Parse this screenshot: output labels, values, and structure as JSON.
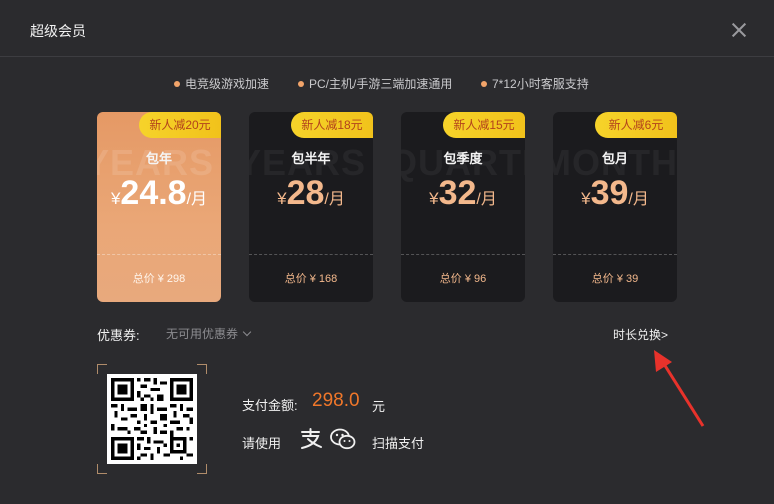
{
  "window": {
    "title": "超级会员"
  },
  "features": [
    {
      "label": "电竞级游戏加速"
    },
    {
      "label": "PC/主机/手游三端加速通用"
    },
    {
      "label": "7*12小时客服支持"
    }
  ],
  "plans": [
    {
      "badge": "新人减20元",
      "watermark": "YEARS",
      "name": "包年",
      "currency": "¥",
      "price": "24.8",
      "unit": "/月",
      "total": "总价 ¥ 298",
      "selected": true
    },
    {
      "badge": "新人减18元",
      "watermark": "YEARS",
      "name": "包半年",
      "currency": "¥",
      "price": "28",
      "unit": "/月",
      "total": "总价 ¥ 168",
      "selected": false
    },
    {
      "badge": "新人减15元",
      "watermark": "QUARTER",
      "name": "包季度",
      "currency": "¥",
      "price": "32",
      "unit": "/月",
      "total": "总价 ¥ 96",
      "selected": false
    },
    {
      "badge": "新人减6元",
      "watermark": "MONTH",
      "name": "包月",
      "currency": "¥",
      "price": "39",
      "unit": "/月",
      "total": "总价 ¥ 39",
      "selected": false
    }
  ],
  "coupon": {
    "label": "优惠券:",
    "value": "无可用优惠券"
  },
  "redeem": {
    "label": "时长兑换>"
  },
  "payment": {
    "amount_label": "支付金额:",
    "amount": "298.0",
    "unit": "元",
    "use_label": "请使用",
    "scan_label": "扫描支付",
    "methods": [
      "alipay-icon",
      "wechat-pay-icon"
    ]
  },
  "colors": {
    "background": "#2b2b2e",
    "card": "#1b1b1e",
    "selected_card": "#e59965",
    "accent_price": "#f3b88c",
    "pay_amount": "#f0772a",
    "badge": "#f6d32a",
    "badge_text": "#b3421c",
    "annotation": "#e8322b"
  }
}
